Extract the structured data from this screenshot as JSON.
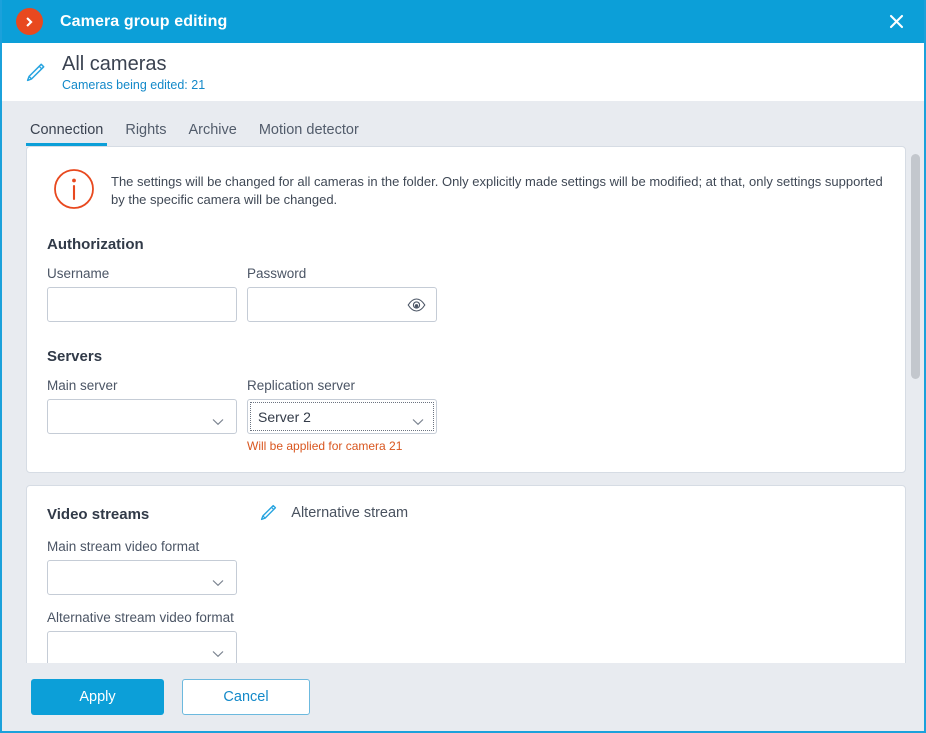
{
  "titlebar": {
    "title": "Camera group editing",
    "logo_icon": "chevron-right-circle-icon",
    "close_icon": "close-icon",
    "accent_color": "#0c9fd8",
    "logo_color": "#e8491f"
  },
  "header": {
    "pencil_icon": "pencil-icon",
    "title": "All cameras",
    "subtitle": "Cameras being edited: 21",
    "subtitle_color": "#1389c9"
  },
  "tabs": [
    {
      "label": "Connection",
      "active": true
    },
    {
      "label": "Rights",
      "active": false
    },
    {
      "label": "Archive",
      "active": false
    },
    {
      "label": "Motion detector",
      "active": false
    }
  ],
  "info_banner": {
    "icon": "info-circle-icon",
    "icon_color": "#e8491f",
    "text": "The settings will be changed for all cameras in the folder. Only explicitly made settings will be modified; at that, only settings supported by the specific camera will be changed."
  },
  "authorization": {
    "section_title": "Authorization",
    "username": {
      "label": "Username",
      "value": "",
      "placeholder": ""
    },
    "password": {
      "label": "Password",
      "value": "",
      "placeholder": "",
      "reveal_icon": "eye-icon"
    }
  },
  "servers": {
    "section_title": "Servers",
    "main_server": {
      "label": "Main server",
      "value": "",
      "chevron_icon": "chevron-down-icon"
    },
    "replication_server": {
      "label": "Replication server",
      "value": "Server 2",
      "chevron_icon": "chevron-down-icon",
      "focused": true,
      "validation": "Will be applied for camera 21",
      "validation_color": "#d9561f"
    }
  },
  "video_streams": {
    "section_title": "Video streams",
    "alternative_stream": {
      "label": "Alternative stream",
      "icon": "pencil-icon"
    },
    "main_stream_format": {
      "label": "Main stream video format",
      "value": "",
      "chevron_icon": "chevron-down-icon"
    },
    "alt_stream_format": {
      "label": "Alternative stream video format",
      "value": "",
      "chevron_icon": "chevron-down-icon"
    }
  },
  "scrollbar": {
    "thumb_color": "#c3c7cd"
  },
  "footer": {
    "apply_label": "Apply",
    "cancel_label": "Cancel"
  }
}
